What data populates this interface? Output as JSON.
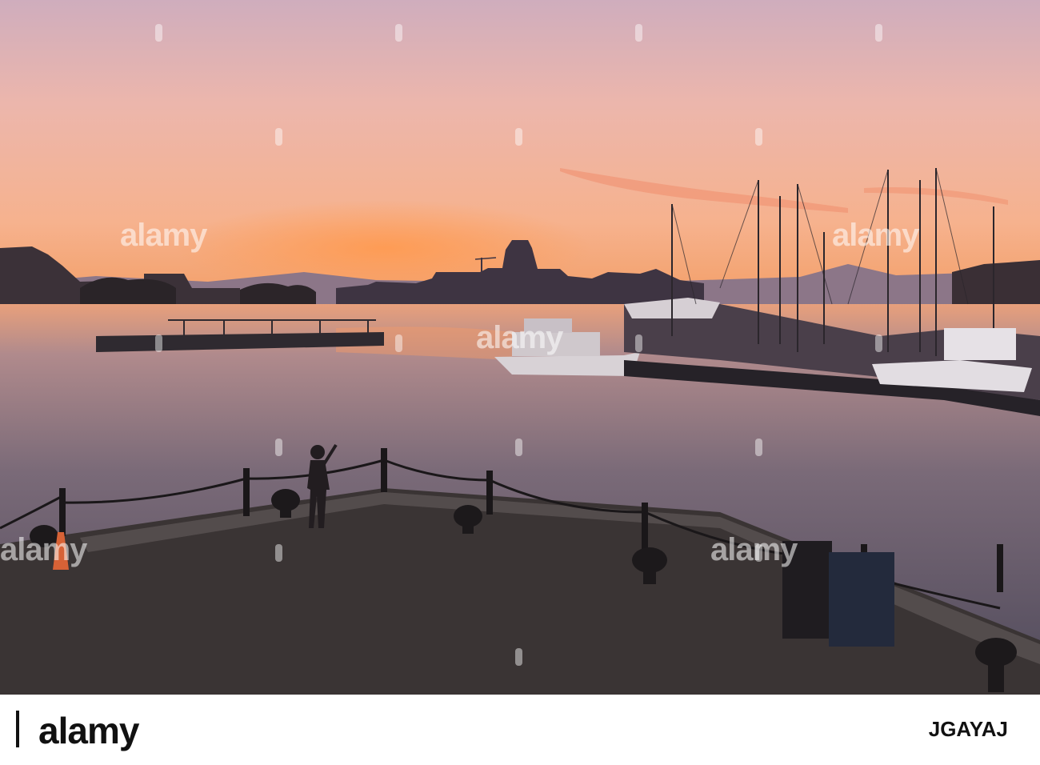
{
  "photo": {
    "subject": "Harbour marina at sunset with a silhouetted person photographing the sky from a waterfront pier",
    "watermark_text": "alamy"
  },
  "footer": {
    "brand": "alamy",
    "image_id": "JGAYAJ"
  },
  "colors": {
    "sky_top": "#d9b3bd",
    "sky_mid": "#f2b8a4",
    "horizon": "#f59a5c",
    "water": "#7e6d7a",
    "pier": "#3a3434"
  }
}
